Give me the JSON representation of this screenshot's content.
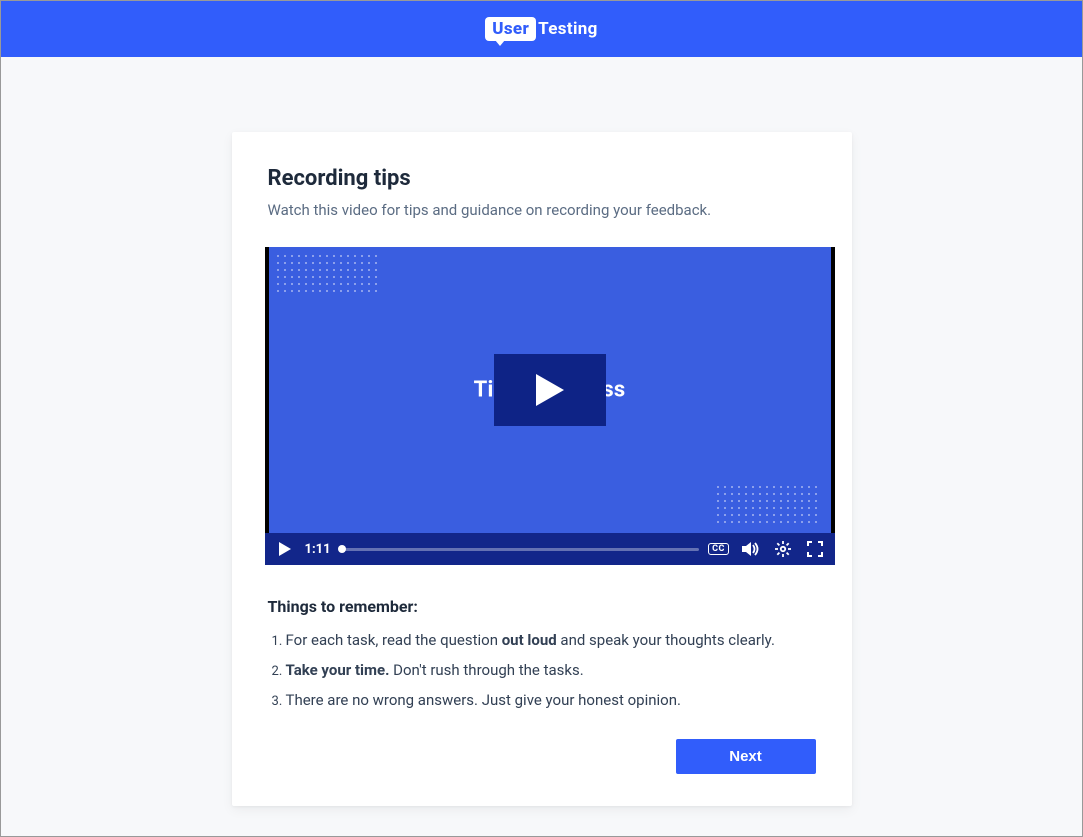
{
  "brand": {
    "user": "User",
    "testing": "Testing"
  },
  "card": {
    "title": "Recording tips",
    "subtitle": "Watch this video for tips and guidance on recording your feedback."
  },
  "video": {
    "title_left": "Ti",
    "title_right": "ess",
    "duration": "1:11",
    "cc_label": "CC"
  },
  "section": {
    "heading": "Things to remember:",
    "items": [
      {
        "pre": "For each task, read the question ",
        "bold": "out loud",
        "post": " and speak your thoughts clearly."
      },
      {
        "pre": "",
        "bold": "Take your time.",
        "post": " Don't rush through the tasks."
      },
      {
        "pre": "There are no wrong answers. Just give your honest opinion.",
        "bold": "",
        "post": ""
      }
    ]
  },
  "actions": {
    "next": "Next"
  }
}
